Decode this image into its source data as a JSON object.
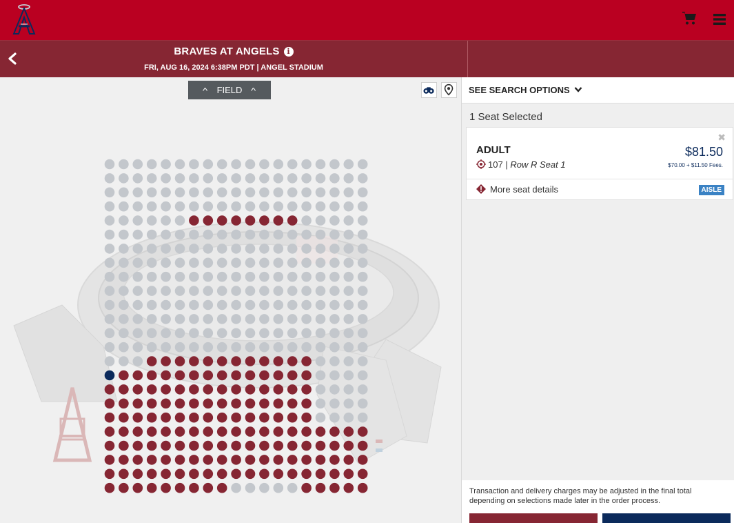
{
  "header": {
    "logo_icon": "angels-logo",
    "cart_icon": "cart-icon",
    "menu_icon": "hamburger-menu-icon",
    "brand_color": "#ba0021"
  },
  "event": {
    "title": "BRAVES AT ANGELS",
    "info_symbol": "i",
    "subtitle": "FRI, AUG 16, 2024 6:38PM PDT | ANGEL STADIUM",
    "bar_color": "#862633"
  },
  "map": {
    "field_label": "FIELD",
    "binoculars_icon": "binoculars-icon",
    "pin_icon": "map-pin-icon",
    "seat_colors": {
      "available": "#862633",
      "unavailable": "#c3c7cc",
      "selected": "#0b2a5b"
    },
    "rows": [
      "ggggggggggggggggggg",
      "ggggggggggggggggggg",
      "ggggggggggggggggggg",
      "ggggggggggggggggggg",
      "ggggggaaaaaaaaggggg",
      "ggggggggggggggggggg",
      "ggggggggggggggggggg",
      "ggggggggggggggggggg",
      "ggggggggggggggggggg",
      "ggggggggggggggggggg",
      "ggggggggggggggggggg",
      "ggggggggggggggggggg",
      "ggggggggggggggggggg",
      "ggggggggggggggggggg",
      "gggaaaaaaaaaaaagggg",
      "saaaaaaaaaaaaaagggg",
      "aaaaaaaaaaaaaaagggg",
      "aaaaaaaaaaaaaaagggg",
      "aaaaaaaaaaaaaaagggg",
      "aaaaaaaaaaaaaaaaaaa",
      "aaaaaaaaaaaaaaaaaaa",
      "aaaaaaaaaaaaaaaaaaa",
      "aaaaaaaaaaaaaaaaaaa",
      "aaaaaaaaagggggaaaaa"
    ]
  },
  "panel": {
    "search_options": "SEE SEARCH OPTIONS",
    "seat_count": "1 Seat Selected",
    "ticket": {
      "type": "ADULT",
      "section": "107",
      "separator": "|",
      "row_seat": "Row R Seat 1",
      "price": "$81.50",
      "fees": "$70.00 + $11.50 Fees.",
      "close_symbol": "✖",
      "more_details": "More seat details",
      "aisle_badge": "AISLE"
    },
    "note": "Transaction and delivery charges may be adjusted in the final total depending on selections made later in the order process."
  }
}
